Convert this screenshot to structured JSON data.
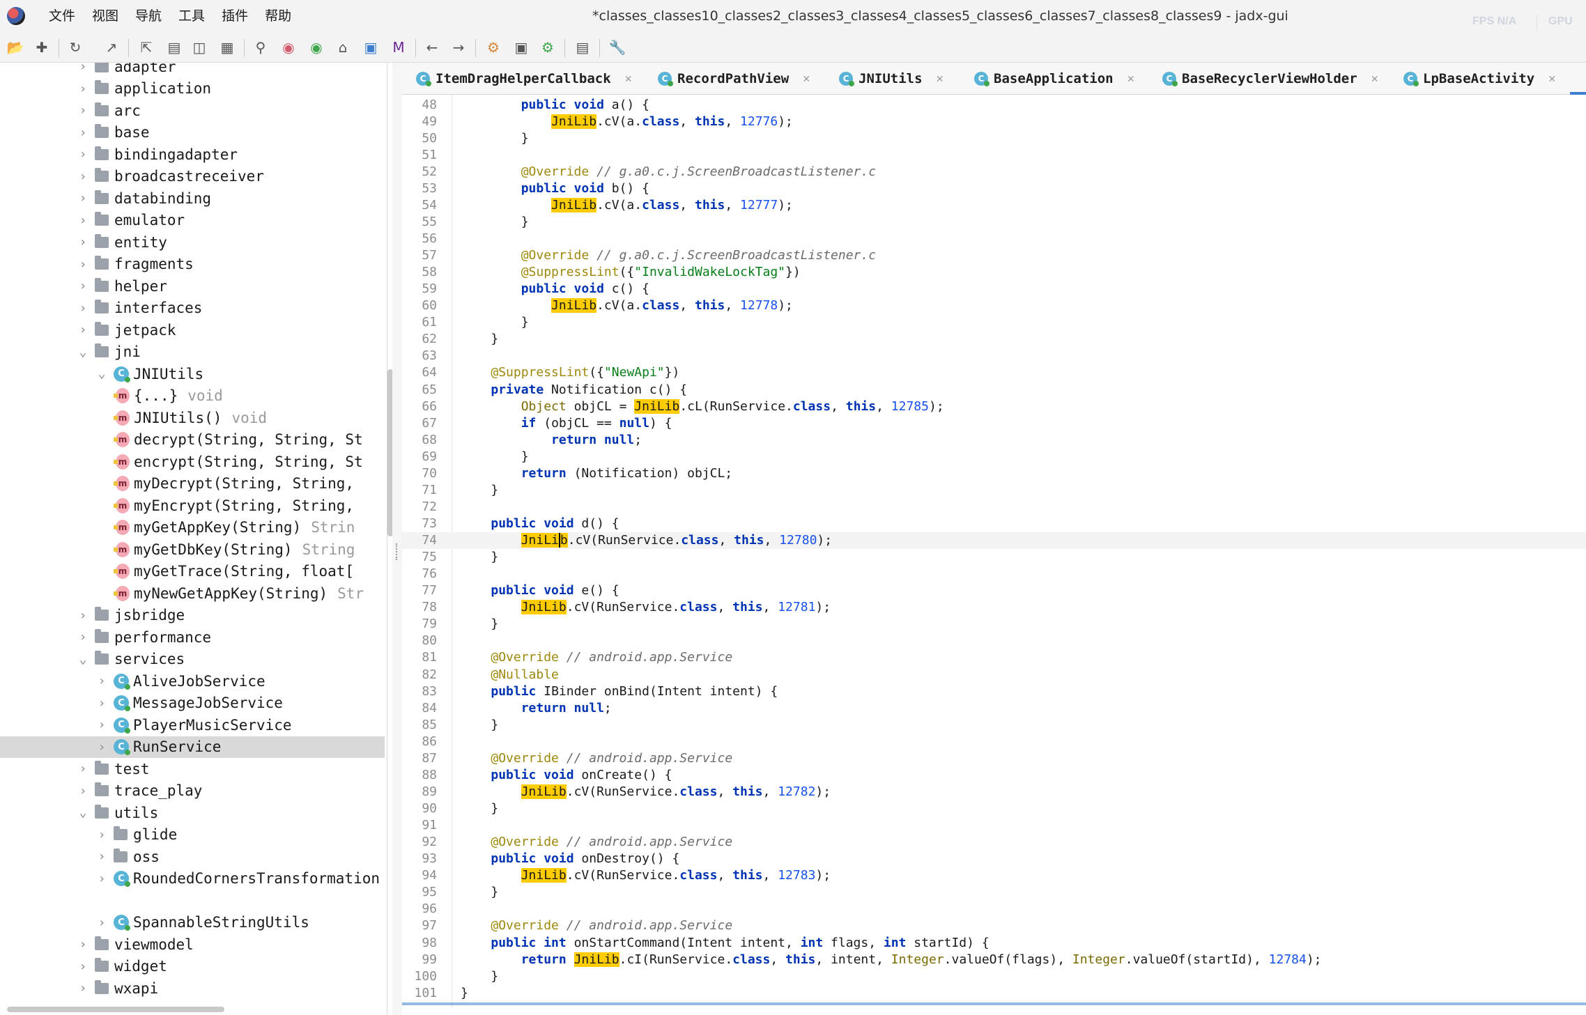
{
  "window": {
    "title": "*classes_classes10_classes2_classes3_classes4_classes5_classes6_classes7_classes8_classes9 - jadx-gui",
    "perf_fps": "FPS N/A",
    "perf_gpu": "GPU"
  },
  "menu": [
    "文件",
    "视图",
    "导航",
    "工具",
    "插件",
    "帮助"
  ],
  "toolbar_icons": [
    "open-file-icon",
    "add-files-icon",
    "reload-icon",
    "export-icon",
    "sync-tree-icon",
    "flatten-packages-icon",
    "split-view-icon",
    "table-view-icon",
    "search-icon",
    "find-class-icon",
    "find-usage-icon",
    "home-icon",
    "deobfuscation-icon",
    "mapping-icon",
    "back-icon",
    "forward-icon",
    "decompile-all-icon",
    "quark-icon",
    "debugger-icon",
    "log-icon",
    "preferences-icon"
  ],
  "tree": [
    {
      "label": "adapter",
      "kind": "package",
      "depth": 0,
      "expanded": false
    },
    {
      "label": "application",
      "kind": "package",
      "depth": 0,
      "expanded": false
    },
    {
      "label": "arc",
      "kind": "package",
      "depth": 0,
      "expanded": false
    },
    {
      "label": "base",
      "kind": "package",
      "depth": 0,
      "expanded": false
    },
    {
      "label": "bindingadapter",
      "kind": "package",
      "depth": 0,
      "expanded": false
    },
    {
      "label": "broadcastreceiver",
      "kind": "package",
      "depth": 0,
      "expanded": false
    },
    {
      "label": "databinding",
      "kind": "package",
      "depth": 0,
      "expanded": false
    },
    {
      "label": "emulator",
      "kind": "package",
      "depth": 0,
      "expanded": false
    },
    {
      "label": "entity",
      "kind": "package",
      "depth": 0,
      "expanded": false
    },
    {
      "label": "fragments",
      "kind": "package",
      "depth": 0,
      "expanded": false
    },
    {
      "label": "helper",
      "kind": "package",
      "depth": 0,
      "expanded": false
    },
    {
      "label": "interfaces",
      "kind": "package",
      "depth": 0,
      "expanded": false
    },
    {
      "label": "jetpack",
      "kind": "package",
      "depth": 0,
      "expanded": false
    },
    {
      "label": "jni",
      "kind": "package",
      "depth": 0,
      "expanded": true
    },
    {
      "label": "JNIUtils",
      "kind": "class",
      "depth": 1,
      "expanded": true
    },
    {
      "label": "{...}",
      "kind": "method",
      "depth": 2,
      "type": "void"
    },
    {
      "label": "JNIUtils()",
      "kind": "method",
      "depth": 2,
      "type": "void"
    },
    {
      "label": "decrypt(String, String, St",
      "kind": "method",
      "depth": 2,
      "type": ""
    },
    {
      "label": "encrypt(String, String, St",
      "kind": "method",
      "depth": 2,
      "type": ""
    },
    {
      "label": "myDecrypt(String, String,",
      "kind": "method",
      "depth": 2,
      "type": ""
    },
    {
      "label": "myEncrypt(String, String,",
      "kind": "method",
      "depth": 2,
      "type": ""
    },
    {
      "label": "myGetAppKey(String)",
      "kind": "method",
      "depth": 2,
      "type": "Strin"
    },
    {
      "label": "myGetDbKey(String)",
      "kind": "method",
      "depth": 2,
      "type": "String"
    },
    {
      "label": "myGetTrace(String, float[",
      "kind": "method",
      "depth": 2,
      "type": ""
    },
    {
      "label": "myNewGetAppKey(String)",
      "kind": "method",
      "depth": 2,
      "type": "Str"
    },
    {
      "label": "jsbridge",
      "kind": "package",
      "depth": 0,
      "expanded": false
    },
    {
      "label": "performance",
      "kind": "package",
      "depth": 0,
      "expanded": false
    },
    {
      "label": "services",
      "kind": "package",
      "depth": 0,
      "expanded": true
    },
    {
      "label": "AliveJobService",
      "kind": "class",
      "depth": 1,
      "expanded": false
    },
    {
      "label": "MessageJobService",
      "kind": "class",
      "depth": 1,
      "expanded": false
    },
    {
      "label": "PlayerMusicService",
      "kind": "class",
      "depth": 1,
      "expanded": false
    },
    {
      "label": "RunService",
      "kind": "class",
      "depth": 1,
      "expanded": false,
      "selected": true
    },
    {
      "label": "test",
      "kind": "package",
      "depth": 0,
      "expanded": false
    },
    {
      "label": "trace_play",
      "kind": "package",
      "depth": 0,
      "expanded": false
    },
    {
      "label": "utils",
      "kind": "package",
      "depth": 0,
      "expanded": true
    },
    {
      "label": "glide",
      "kind": "package",
      "depth": 1,
      "expanded": false
    },
    {
      "label": "oss",
      "kind": "package",
      "depth": 1,
      "expanded": false
    },
    {
      "label": "RoundedCornersTransformation",
      "kind": "class",
      "depth": 1,
      "expanded": false
    },
    {
      "label": "",
      "kind": "blank",
      "depth": 1
    },
    {
      "label": "SpannableStringUtils",
      "kind": "class",
      "depth": 1,
      "expanded": false
    },
    {
      "label": "viewmodel",
      "kind": "package",
      "depth": 0,
      "expanded": false
    },
    {
      "label": "widget",
      "kind": "package",
      "depth": 0,
      "expanded": false
    },
    {
      "label": "wxapi",
      "kind": "package",
      "depth": 0,
      "expanded": false
    }
  ],
  "tabs": [
    {
      "label": "ItemDragHelperCallback"
    },
    {
      "label": "RecordPathView"
    },
    {
      "label": "JNIUtils"
    },
    {
      "label": "BaseApplication"
    },
    {
      "label": "BaseRecyclerViewHolder"
    },
    {
      "label": "LpBaseActivity"
    }
  ],
  "code": {
    "first_line": 48,
    "current_line": 74,
    "lines": [
      [
        [
          "        "
        ],
        [
          "public void",
          "kw"
        ],
        [
          " a() {"
        ]
      ],
      [
        [
          "            "
        ],
        [
          "JniLib",
          "hl"
        ],
        [
          ".cV(a."
        ],
        [
          "class",
          "kw"
        ],
        [
          ", "
        ],
        [
          "this",
          "kw"
        ],
        [
          ", "
        ],
        [
          "12776",
          "num"
        ],
        [
          ");"
        ]
      ],
      [
        [
          "        }"
        ]
      ],
      [
        [
          ""
        ]
      ],
      [
        [
          "        "
        ],
        [
          "@Override",
          "ann"
        ],
        [
          " "
        ],
        [
          "// g.a0.c.j.ScreenBroadcastListener.c",
          "cm"
        ]
      ],
      [
        [
          "        "
        ],
        [
          "public void",
          "kw"
        ],
        [
          " b() {"
        ]
      ],
      [
        [
          "            "
        ],
        [
          "JniLib",
          "hl"
        ],
        [
          ".cV(a."
        ],
        [
          "class",
          "kw"
        ],
        [
          ", "
        ],
        [
          "this",
          "kw"
        ],
        [
          ", "
        ],
        [
          "12777",
          "num"
        ],
        [
          ");"
        ]
      ],
      [
        [
          "        }"
        ]
      ],
      [
        [
          ""
        ]
      ],
      [
        [
          "        "
        ],
        [
          "@Override",
          "ann"
        ],
        [
          " "
        ],
        [
          "// g.a0.c.j.ScreenBroadcastListener.c",
          "cm"
        ]
      ],
      [
        [
          "        "
        ],
        [
          "@SuppressLint",
          "ann"
        ],
        [
          "({"
        ],
        [
          "\"InvalidWakeLockTag\"",
          "str"
        ],
        [
          "})"
        ]
      ],
      [
        [
          "        "
        ],
        [
          "public void",
          "kw"
        ],
        [
          " c() {"
        ]
      ],
      [
        [
          "            "
        ],
        [
          "JniLib",
          "hl"
        ],
        [
          ".cV(a."
        ],
        [
          "class",
          "kw"
        ],
        [
          ", "
        ],
        [
          "this",
          "kw"
        ],
        [
          ", "
        ],
        [
          "12778",
          "num"
        ],
        [
          ");"
        ]
      ],
      [
        [
          "        }"
        ]
      ],
      [
        [
          "    }"
        ]
      ],
      [
        [
          ""
        ]
      ],
      [
        [
          "    "
        ],
        [
          "@SuppressLint",
          "ann"
        ],
        [
          "({"
        ],
        [
          "\"NewApi\"",
          "str"
        ],
        [
          "})"
        ]
      ],
      [
        [
          "    "
        ],
        [
          "private",
          "kw"
        ],
        [
          " Notification c() {"
        ]
      ],
      [
        [
          "        "
        ],
        [
          "Object",
          "ty"
        ],
        [
          " objCL = "
        ],
        [
          "JniLib",
          "hl"
        ],
        [
          ".cL(RunService."
        ],
        [
          "class",
          "kw"
        ],
        [
          ", "
        ],
        [
          "this",
          "kw"
        ],
        [
          ", "
        ],
        [
          "12785",
          "num"
        ],
        [
          ");"
        ]
      ],
      [
        [
          "        "
        ],
        [
          "if",
          "kw"
        ],
        [
          " (objCL == "
        ],
        [
          "null",
          "kw"
        ],
        [
          ") {"
        ]
      ],
      [
        [
          "            "
        ],
        [
          "return null",
          "kw"
        ],
        [
          ";"
        ]
      ],
      [
        [
          "        }"
        ]
      ],
      [
        [
          "        "
        ],
        [
          "return",
          "kw"
        ],
        [
          " (Notification) objCL;"
        ]
      ],
      [
        [
          "    }"
        ]
      ],
      [
        [
          ""
        ]
      ],
      [
        [
          "    "
        ],
        [
          "public void",
          "kw"
        ],
        [
          " d() {"
        ]
      ],
      [
        [
          "        "
        ],
        [
          "JniLi",
          "hl"
        ],
        [
          "b",
          "hlc"
        ],
        [
          ".cV(RunService."
        ],
        [
          "class",
          "kw"
        ],
        [
          ", "
        ],
        [
          "this",
          "kw"
        ],
        [
          ", "
        ],
        [
          "12780",
          "num"
        ],
        [
          ");"
        ]
      ],
      [
        [
          "    }"
        ]
      ],
      [
        [
          ""
        ]
      ],
      [
        [
          "    "
        ],
        [
          "public void",
          "kw"
        ],
        [
          " e() {"
        ]
      ],
      [
        [
          "        "
        ],
        [
          "JniLib",
          "hl"
        ],
        [
          ".cV(RunService."
        ],
        [
          "class",
          "kw"
        ],
        [
          ", "
        ],
        [
          "this",
          "kw"
        ],
        [
          ", "
        ],
        [
          "12781",
          "num"
        ],
        [
          ");"
        ]
      ],
      [
        [
          "    }"
        ]
      ],
      [
        [
          ""
        ]
      ],
      [
        [
          "    "
        ],
        [
          "@Override",
          "ann"
        ],
        [
          " "
        ],
        [
          "// android.app.Service",
          "cm"
        ]
      ],
      [
        [
          "    "
        ],
        [
          "@Nullable",
          "ann"
        ]
      ],
      [
        [
          "    "
        ],
        [
          "public",
          "kw"
        ],
        [
          " IBinder onBind(Intent intent) {"
        ]
      ],
      [
        [
          "        "
        ],
        [
          "return null",
          "kw"
        ],
        [
          ";"
        ]
      ],
      [
        [
          "    }"
        ]
      ],
      [
        [
          ""
        ]
      ],
      [
        [
          "    "
        ],
        [
          "@Override",
          "ann"
        ],
        [
          " "
        ],
        [
          "// android.app.Service",
          "cm"
        ]
      ],
      [
        [
          "    "
        ],
        [
          "public void",
          "kw"
        ],
        [
          " onCreate() {"
        ]
      ],
      [
        [
          "        "
        ],
        [
          "JniLib",
          "hl"
        ],
        [
          ".cV(RunService."
        ],
        [
          "class",
          "kw"
        ],
        [
          ", "
        ],
        [
          "this",
          "kw"
        ],
        [
          ", "
        ],
        [
          "12782",
          "num"
        ],
        [
          ");"
        ]
      ],
      [
        [
          "    }"
        ]
      ],
      [
        [
          ""
        ]
      ],
      [
        [
          "    "
        ],
        [
          "@Override",
          "ann"
        ],
        [
          " "
        ],
        [
          "// android.app.Service",
          "cm"
        ]
      ],
      [
        [
          "    "
        ],
        [
          "public void",
          "kw"
        ],
        [
          " onDestroy() {"
        ]
      ],
      [
        [
          "        "
        ],
        [
          "JniLib",
          "hl"
        ],
        [
          ".cV(RunService."
        ],
        [
          "class",
          "kw"
        ],
        [
          ", "
        ],
        [
          "this",
          "kw"
        ],
        [
          ", "
        ],
        [
          "12783",
          "num"
        ],
        [
          ");"
        ]
      ],
      [
        [
          "    }"
        ]
      ],
      [
        [
          ""
        ]
      ],
      [
        [
          "    "
        ],
        [
          "@Override",
          "ann"
        ],
        [
          " "
        ],
        [
          "// android.app.Service",
          "cm"
        ]
      ],
      [
        [
          "    "
        ],
        [
          "public int",
          "kw"
        ],
        [
          " onStartCommand(Intent intent, "
        ],
        [
          "int",
          "kw"
        ],
        [
          " flags, "
        ],
        [
          "int",
          "kw"
        ],
        [
          " startId) {"
        ]
      ],
      [
        [
          "        "
        ],
        [
          "return",
          "kw"
        ],
        [
          " "
        ],
        [
          "JniLib",
          "hl"
        ],
        [
          ".cI(RunService."
        ],
        [
          "class",
          "kw"
        ],
        [
          ", "
        ],
        [
          "this",
          "kw"
        ],
        [
          ", intent, "
        ],
        [
          "Integer",
          "ty"
        ],
        [
          ".valueOf(flags), "
        ],
        [
          "Integer",
          "ty"
        ],
        [
          ".valueOf(startId), "
        ],
        [
          "12784",
          "num"
        ],
        [
          ");"
        ]
      ],
      [
        [
          "    }"
        ]
      ],
      [
        [
          "}"
        ]
      ]
    ]
  }
}
